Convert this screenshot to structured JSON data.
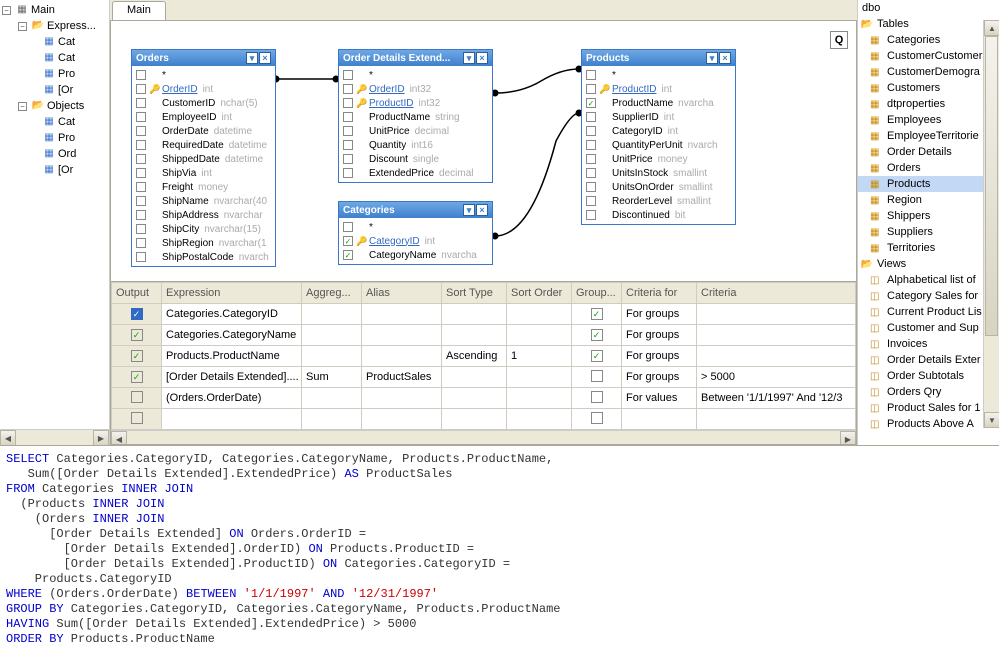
{
  "leftTree": {
    "root": "Main",
    "folders": [
      {
        "name": "Express...",
        "children": [
          "Cat",
          "Cat",
          "Pro",
          "[Or"
        ]
      },
      {
        "name": "Objects",
        "children": [
          "Cat",
          "Pro",
          "Ord",
          "[Or"
        ]
      }
    ]
  },
  "tabs": {
    "active": "Main"
  },
  "qButton": "Q",
  "tables": {
    "orders": {
      "title": "Orders",
      "columns": [
        {
          "chk": false,
          "pk": true,
          "name": "OrderID",
          "type": "int"
        },
        {
          "chk": false,
          "name": "CustomerID",
          "type": "nchar(5)"
        },
        {
          "chk": false,
          "name": "EmployeeID",
          "type": "int"
        },
        {
          "chk": false,
          "name": "OrderDate",
          "type": "datetime"
        },
        {
          "chk": false,
          "name": "RequiredDate",
          "type": "datetime"
        },
        {
          "chk": false,
          "name": "ShippedDate",
          "type": "datetime"
        },
        {
          "chk": false,
          "name": "ShipVia",
          "type": "int"
        },
        {
          "chk": false,
          "name": "Freight",
          "type": "money"
        },
        {
          "chk": false,
          "name": "ShipName",
          "type": "nvarchar(40"
        },
        {
          "chk": false,
          "name": "ShipAddress",
          "type": "nvarchar"
        },
        {
          "chk": false,
          "name": "ShipCity",
          "type": "nvarchar(15)"
        },
        {
          "chk": false,
          "name": "ShipRegion",
          "type": "nvarchar(1"
        },
        {
          "chk": false,
          "name": "ShipPostalCode",
          "type": "nvarch"
        }
      ],
      "star": "*"
    },
    "orderDetailsExt": {
      "title": "Order Details Extend...",
      "columns": [
        {
          "chk": false,
          "pk": true,
          "name": "OrderID",
          "type": "int32"
        },
        {
          "chk": false,
          "pk": true,
          "name": "ProductID",
          "type": "int32"
        },
        {
          "chk": false,
          "name": "ProductName",
          "type": "string"
        },
        {
          "chk": false,
          "name": "UnitPrice",
          "type": "decimal"
        },
        {
          "chk": false,
          "name": "Quantity",
          "type": "int16"
        },
        {
          "chk": false,
          "name": "Discount",
          "type": "single"
        },
        {
          "chk": false,
          "name": "ExtendedPrice",
          "type": "decimal"
        }
      ],
      "star": "*"
    },
    "categories": {
      "title": "Categories",
      "columns": [
        {
          "chk": true,
          "pk": true,
          "name": "CategoryID",
          "type": "int"
        },
        {
          "chk": true,
          "name": "CategoryName",
          "type": "nvarcha"
        }
      ],
      "star": "*"
    },
    "products": {
      "title": "Products",
      "columns": [
        {
          "chk": false,
          "pk": true,
          "name": "ProductID",
          "type": "int"
        },
        {
          "chk": true,
          "name": "ProductName",
          "type": "nvarcha"
        },
        {
          "chk": false,
          "name": "SupplierID",
          "type": "int"
        },
        {
          "chk": false,
          "name": "CategoryID",
          "type": "int"
        },
        {
          "chk": false,
          "name": "QuantityPerUnit",
          "type": "nvarch"
        },
        {
          "chk": false,
          "name": "UnitPrice",
          "type": "money"
        },
        {
          "chk": false,
          "name": "UnitsInStock",
          "type": "smallint"
        },
        {
          "chk": false,
          "name": "UnitsOnOrder",
          "type": "smallint"
        },
        {
          "chk": false,
          "name": "ReorderLevel",
          "type": "smallint"
        },
        {
          "chk": false,
          "name": "Discontinued",
          "type": "bit"
        }
      ],
      "star": "*"
    }
  },
  "grid": {
    "headers": [
      "Output",
      "Expression",
      "Aggreg...",
      "Alias",
      "Sort Type",
      "Sort Order",
      "Group...",
      "Criteria for",
      "Criteria"
    ],
    "rows": [
      {
        "output": "blue-chk",
        "expression": "Categories.CategoryID",
        "agg": "",
        "alias": "",
        "sortType": "",
        "sortOrder": "",
        "group": true,
        "criteriaFor": "For groups",
        "criteria": ""
      },
      {
        "output": true,
        "expression": "Categories.CategoryName",
        "agg": "",
        "alias": "",
        "sortType": "",
        "sortOrder": "",
        "group": true,
        "criteriaFor": "For groups",
        "criteria": ""
      },
      {
        "output": true,
        "expression": "Products.ProductName",
        "agg": "",
        "alias": "",
        "sortType": "Ascending",
        "sortOrder": "1",
        "group": true,
        "criteriaFor": "For groups",
        "criteria": ""
      },
      {
        "output": true,
        "expression": "[Order Details Extended]....",
        "agg": "Sum",
        "alias": "ProductSales",
        "sortType": "",
        "sortOrder": "",
        "group": false,
        "criteriaFor": "For groups",
        "criteria": "> 5000"
      },
      {
        "output": false,
        "expression": "(Orders.OrderDate)",
        "agg": "",
        "alias": "",
        "sortType": "",
        "sortOrder": "",
        "group": false,
        "criteriaFor": "For values",
        "criteria": "Between '1/1/1997' And '12/3"
      },
      {
        "output": "empty",
        "expression": "",
        "agg": "",
        "alias": "",
        "sortType": "",
        "sortOrder": "",
        "group": false,
        "criteriaFor": "",
        "criteria": ""
      }
    ]
  },
  "rightTree": {
    "schema": "dbo",
    "tablesFolder": "Tables",
    "tables": [
      "Categories",
      "CustomerCustomer",
      "CustomerDemogra",
      "Customers",
      "dtproperties",
      "Employees",
      "EmployeeTerritorie",
      "Order Details",
      "Orders",
      "Products",
      "Region",
      "Shippers",
      "Suppliers",
      "Territories"
    ],
    "highlighted": "Products",
    "viewsFolder": "Views",
    "views": [
      "Alphabetical list of",
      "Category Sales for",
      "Current Product Lis",
      "Customer and Sup",
      "Invoices",
      "Order Details Exter",
      "Order Subtotals",
      "Orders Qry",
      "Product Sales for 1",
      "Products Above A"
    ]
  },
  "sql": {
    "select": "SELECT",
    "selectFields": " Categories.CategoryID, Categories.CategoryName, Products.ProductName,",
    "sumLine": "   Sum([Order Details Extended].ExtendedPrice) ",
    "as": "AS",
    "alias": " ProductSales",
    "from": "FROM",
    "fromLine": " Categories ",
    "innerJoin": "INNER JOIN",
    "join1": "  (Products ",
    "join2": "    (Orders ",
    "on": "ON",
    "onLine1": "      [Order Details Extended] ",
    "onCond1": " Orders.OrderID =",
    "onLine2": "        [Order Details Extended].OrderID) ",
    "onCond2": " Products.ProductID =",
    "onLine3": "        [Order Details Extended].ProductID) ",
    "onCond3": " Categories.CategoryID =",
    "onLine4": "    Products.CategoryID",
    "where": "WHERE",
    "whereLine": " (Orders.OrderDate) ",
    "between": "BETWEEN",
    "and": "AND",
    "dateStr1": "'1/1/1997'",
    "dateStr2": "'12/31/1997'",
    "groupBy": "GROUP BY",
    "groupByLine": " Categories.CategoryID, Categories.CategoryName, Products.ProductName",
    "having": "HAVING",
    "havingLine": " Sum([Order Details Extended].ExtendedPrice) > 5000",
    "orderBy": "ORDER BY",
    "orderByLine": " Products.ProductName"
  }
}
